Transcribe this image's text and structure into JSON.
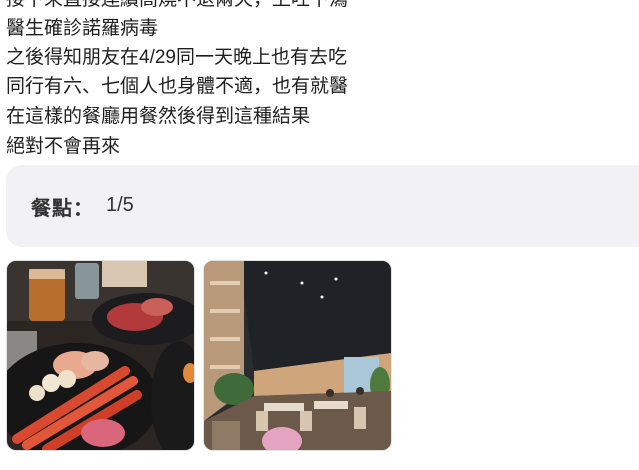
{
  "review": {
    "lines": [
      "接下來直接連續高燒不退兩天，上吐下瀉",
      "醫生確診諾羅病毒",
      "之後得知朋友在4/29同一天晚上也有去吃",
      "同行有六、七個人也身體不適，也有就醫",
      "在這樣的餐廳用餐然後得到這種結果",
      "絕對不會再來"
    ]
  },
  "rating": {
    "label": "餐點：",
    "value": "1/5"
  },
  "photos": [
    {
      "name": "food-photo",
      "description": "seafood and meat platter"
    },
    {
      "name": "interior-photo",
      "description": "restaurant dining room"
    }
  ]
}
